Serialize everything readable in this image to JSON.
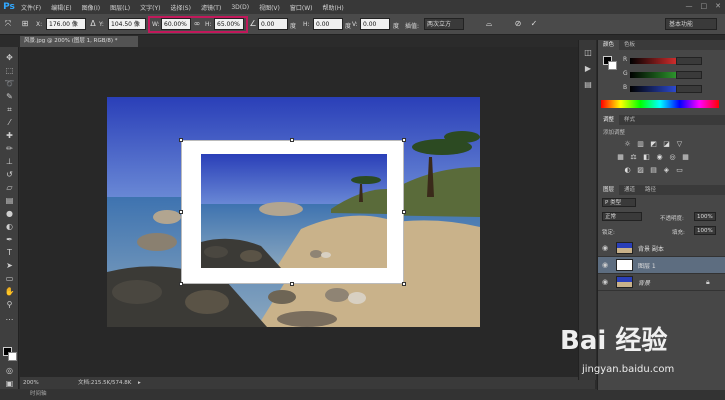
{
  "app": {
    "logo": "Ps"
  },
  "menu": [
    "文件(F)",
    "编辑(E)",
    "图像(I)",
    "图层(L)",
    "文字(Y)",
    "选择(S)",
    "滤镜(T)",
    "3D(D)",
    "视图(V)",
    "窗口(W)",
    "帮助(H)"
  ],
  "options": {
    "x_label": "X:",
    "x_value": "176.00 像",
    "y_label": "Y:",
    "y_value": "104.50 像",
    "w_label": "W:",
    "w_value": "60.00%",
    "h_label": "H:",
    "h_value": "65.00%",
    "angle_value": "0.00",
    "angle_unit": "度",
    "hskew_label": "H:",
    "hskew_value": "0.00",
    "hskew_unit": "度",
    "vskew_label": "V:",
    "vskew_value": "0.00",
    "vskew_unit": "度",
    "interp_label": "插值:",
    "interp_value": "两次立方",
    "workspace": "基本功能"
  },
  "document": {
    "tab_title": "风景.jpg @ 200% (图层 1, RGB/8) *",
    "zoom": "200%",
    "doc_info": "文档:215.5K/574.8K"
  },
  "bottom_tab": "时间轴",
  "color_panel": {
    "tabs": [
      "颜色",
      "色板"
    ],
    "channels": [
      "R",
      "G",
      "B"
    ],
    "channel_colors": [
      "#e03030",
      "#30a030",
      "#3050e0"
    ]
  },
  "adjust_panel": {
    "tabs": [
      "调整",
      "样式"
    ],
    "hint": "添加调整"
  },
  "layers_panel": {
    "tabs": [
      "图层",
      "通道",
      "路径"
    ],
    "filter": "P 类型",
    "blend_mode": "正常",
    "opacity_label": "不透明度:",
    "opacity": "100%",
    "lock_label": "锁定:",
    "fill_label": "填充:",
    "fill": "100%",
    "layers": [
      {
        "name": "背景 副本",
        "selected": false
      },
      {
        "name": "图层 1",
        "selected": true
      },
      {
        "name": "背景",
        "selected": false
      }
    ]
  },
  "watermark": {
    "text": "Bai 经验",
    "url": "jingyan.baidu.com"
  },
  "icons": {
    "eye": "eye-icon",
    "lock": "lock-icon",
    "link": "chain-link-icon",
    "cancel": "cancel-icon",
    "commit": "check-icon"
  }
}
